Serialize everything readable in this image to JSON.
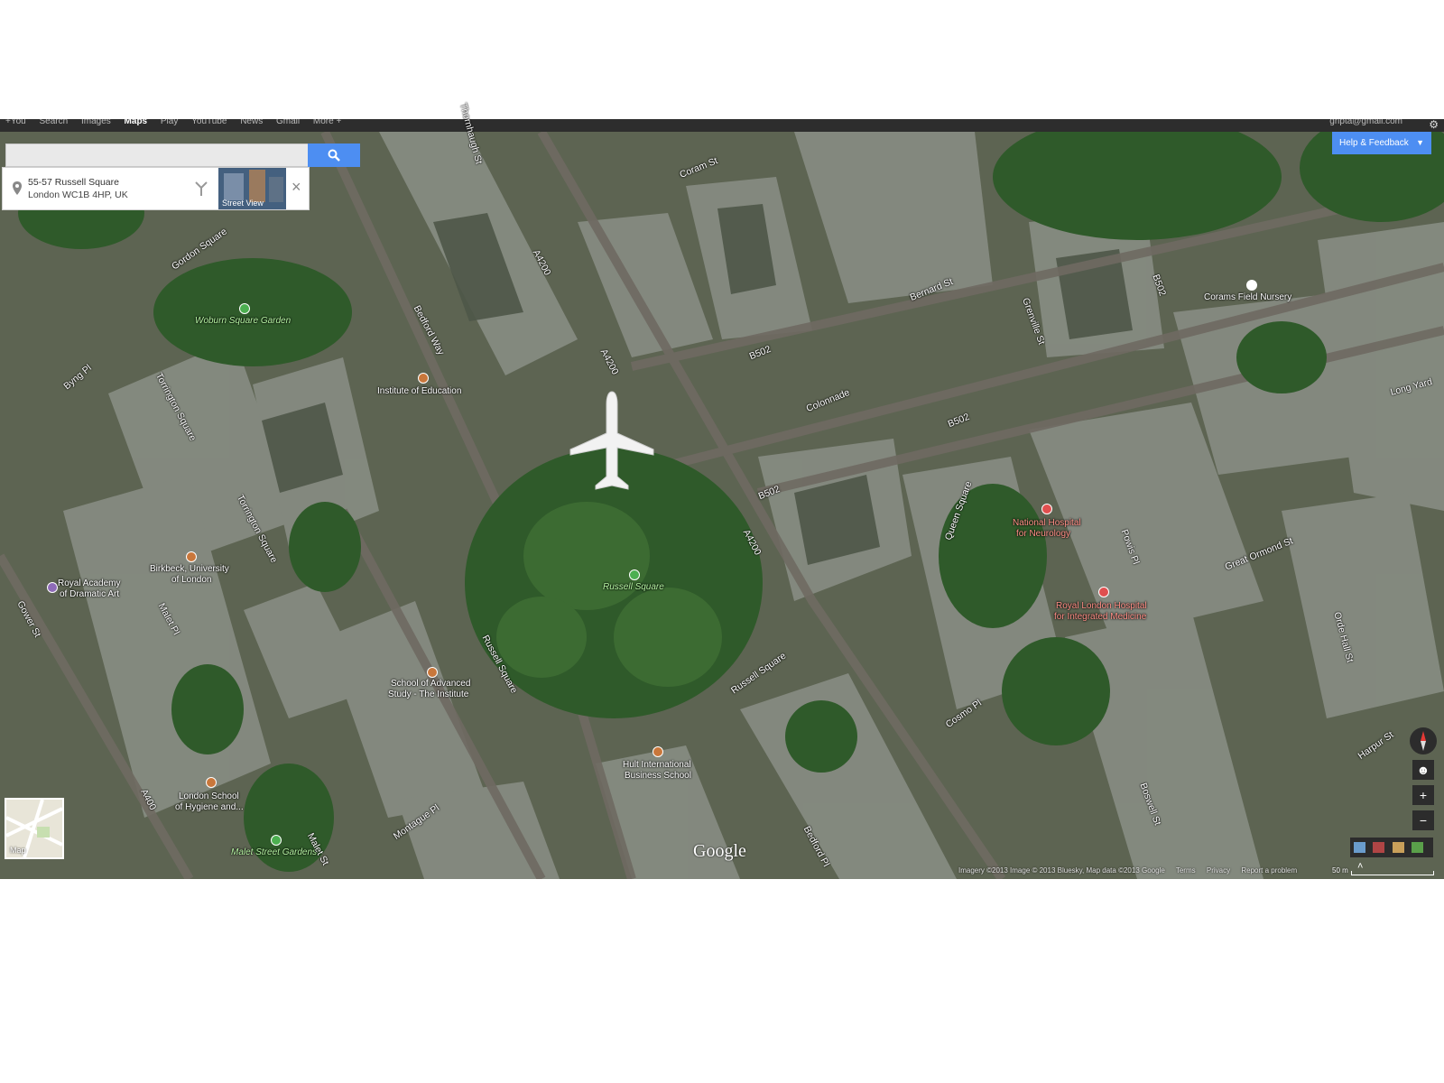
{
  "topbar": {
    "nav": [
      "+You",
      "Search",
      "Images",
      "Maps",
      "Play",
      "YouTube",
      "News",
      "Gmail",
      "More +"
    ],
    "active": "Maps",
    "account": "gripta@gmail.com"
  },
  "search": {
    "value": "",
    "placeholder": ""
  },
  "place_card": {
    "line1": "55-57 Russell Square",
    "line2": "London WC1B 4HP, UK",
    "street_view_label": "Street View"
  },
  "help_button": "Help & Feedback",
  "places": {
    "woburn": "Woburn Square Garden",
    "ioe": "Institute of Education",
    "birkbeck1": "Birkbeck, University",
    "birkbeck2": "of London",
    "rada1": "Royal Academy",
    "rada2": "of Dramatic Art",
    "russell_square": "Russell Square",
    "sas1": "School of Advanced",
    "sas2": "Study - The Institute",
    "hult1": "Hult International",
    "hult2": "Business School",
    "lshtm1": "London School",
    "lshtm2": "of Hygiene and...",
    "malet": "Malet Street Gardens",
    "nhn1": "National Hospital",
    "nhn2": "for Neurology",
    "rlhim1": "Royal London Hospital",
    "rlhim2": "for Integrated Medicine",
    "corams": "Corams Field Nursery"
  },
  "streets": {
    "gordon_sq": "Gordon Square",
    "byng": "Byng Pl",
    "torrington_sq": "Torrington Square",
    "torrington_sq2": "Torrington Square",
    "bedford_way": "Bedford Way",
    "a4200_a": "A4200",
    "a4200_b": "A4200",
    "a4200_c": "A4200",
    "coram": "Coram St",
    "bernard": "Bernard St",
    "b502_a": "B502",
    "b502_b": "B502",
    "b502_c": "B502",
    "b502_d": "B502",
    "grenville": "Grenville St",
    "colonnade": "Colonnade",
    "queen_sq": "Queen Square",
    "powis": "Powis Pl",
    "great_ormond": "Great Ormond St",
    "orde_hall": "Orde Hall St",
    "long_yard": "Long Yard",
    "gower": "Gower St",
    "malet_pl": "Malet Pl",
    "russell_sq_st": "Russell Square",
    "russell_sq_st2": "Russell Square",
    "a400": "A400",
    "montague": "Montague Pl",
    "malet_st": "Malet St",
    "cosmo": "Cosmo Pl",
    "boswell": "Boswell St",
    "harpur": "Harpur St",
    "bedford_pl": "Bedford Pl",
    "thornhaugh": "Thornhaugh St"
  },
  "mini_map_label": "Map",
  "brand": "Google",
  "footer": {
    "imagery": "Imagery ©2013 Image © 2013 Bluesky, Map data ©2013 Google",
    "terms": "Terms",
    "privacy": "Privacy",
    "report": "Report a problem",
    "scale": "50 m"
  },
  "colors": {
    "accent_blue": "#4d8ef2",
    "park_green": "#b6f3a3",
    "hospital_red": "#ff8f86",
    "topbar": "#2d2d2d"
  },
  "icons": [
    "search-icon",
    "pin-icon",
    "directions-icon",
    "close-icon",
    "gear-icon",
    "compass-icon",
    "pegman-icon",
    "zoom-in-icon",
    "zoom-out-icon",
    "layers-icon",
    "chevron-down-icon",
    "airplane-icon"
  ]
}
